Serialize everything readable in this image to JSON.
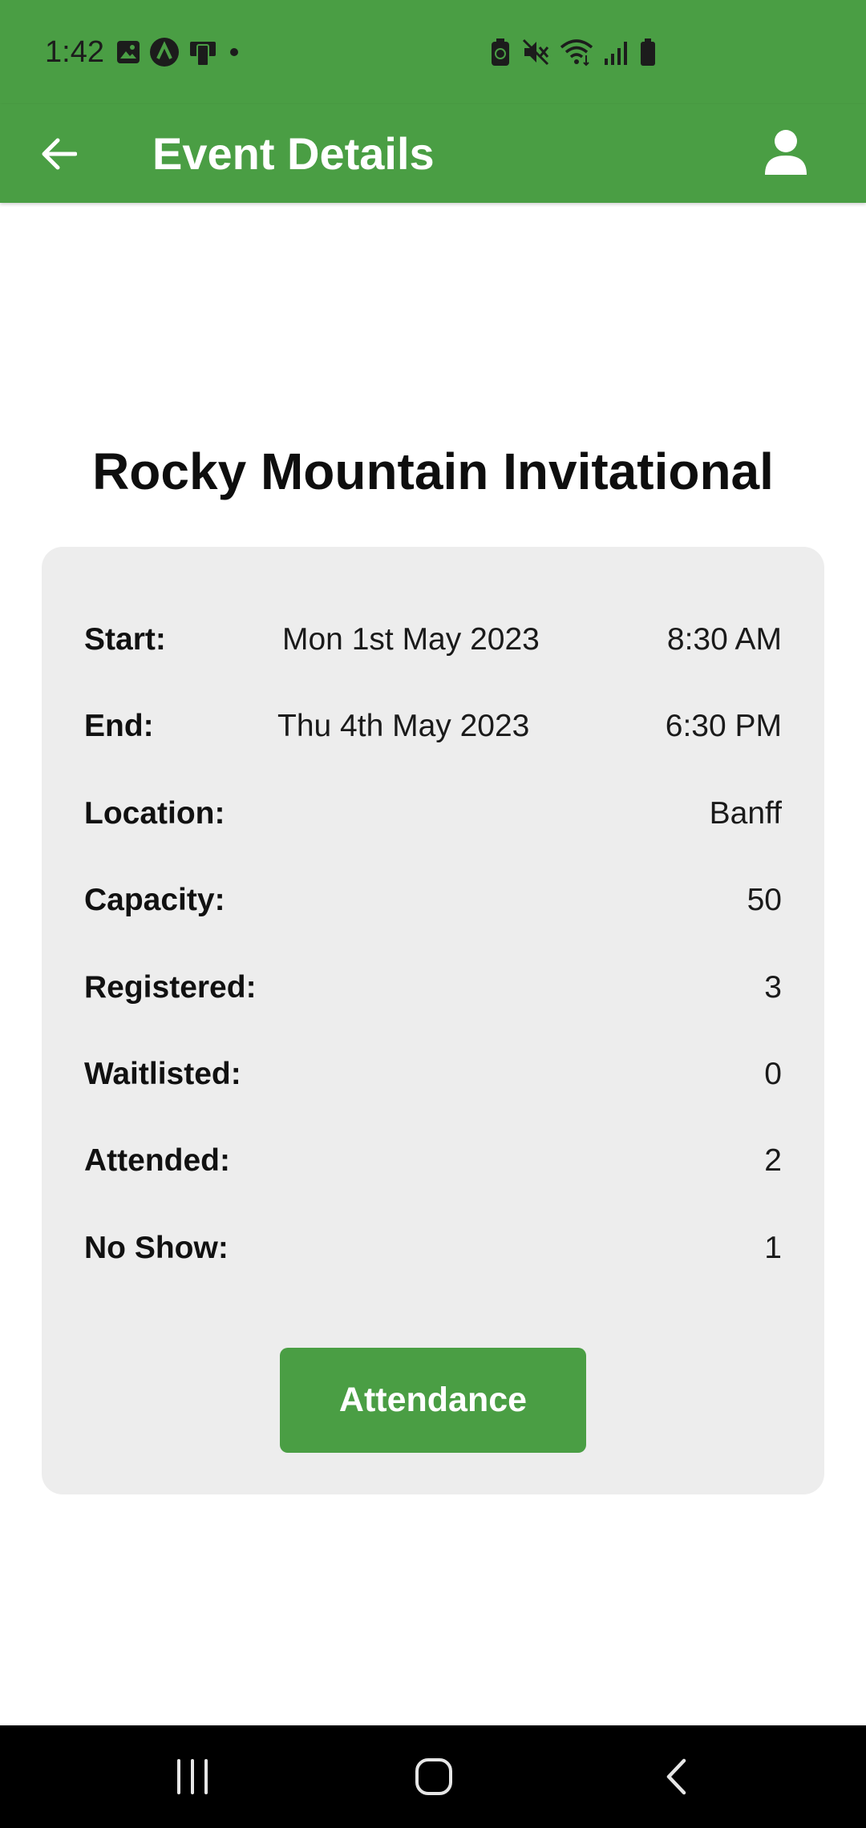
{
  "status_bar": {
    "time": "1:42",
    "left_icons": [
      "gallery-icon",
      "app-badge-icon",
      "device-icon",
      "dot-icon"
    ],
    "right_icons": [
      "battery-saver-icon",
      "mute-icon",
      "wifi-icon",
      "signal-icon",
      "battery-icon"
    ]
  },
  "app_bar": {
    "title": "Event Details",
    "back_icon": "arrow-back-icon",
    "profile_icon": "person-icon",
    "color": "#4a9e44"
  },
  "event": {
    "title": "Rocky Mountain Invitational",
    "details": {
      "start": {
        "label": "Start:",
        "date": "Mon 1st May 2023",
        "time": "8:30 AM"
      },
      "end": {
        "label": "End:",
        "date": "Thu 4th May 2023",
        "time": "6:30 PM"
      },
      "location": {
        "label": "Location:",
        "value": "Banff"
      },
      "capacity": {
        "label": "Capacity:",
        "value": "50"
      },
      "registered": {
        "label": "Registered:",
        "value": "3"
      },
      "waitlisted": {
        "label": "Waitlisted:",
        "value": "0"
      },
      "attended": {
        "label": "Attended:",
        "value": "2"
      },
      "no_show": {
        "label": "No Show:",
        "value": "1"
      }
    },
    "attendance_button": "Attendance"
  },
  "nav_bar": {
    "items": [
      "recents-icon",
      "home-icon",
      "back-icon"
    ]
  }
}
